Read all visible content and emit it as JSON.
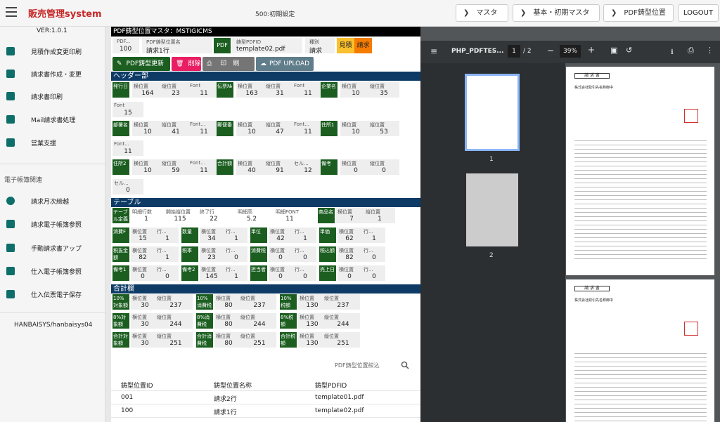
{
  "app": {
    "title": "販売管理system",
    "screen": "500:初期設定",
    "version": "VER:1.0.1",
    "user": "HANBAISYS/hanbaisys04"
  },
  "nav": {
    "master": "マスタ",
    "basic_master": "基本・初期マスタ",
    "pdf_position": "PDF鋳型位置",
    "logout": "LOGOUT"
  },
  "sidebar": {
    "items": [
      {
        "label": "見積作成変更印刷"
      },
      {
        "label": "請求書作成・変更"
      },
      {
        "label": "請求書印刷"
      },
      {
        "label": "Mail請求書処理"
      },
      {
        "label": "営業支援"
      }
    ],
    "section": "電子帳簿関連",
    "items2": [
      {
        "label": "請求月次締越"
      },
      {
        "label": "請求電子帳簿参照"
      },
      {
        "label": "手動請求書アップ"
      },
      {
        "label": "仕入電子帳簿参照"
      },
      {
        "label": "仕入伝票電子保存"
      }
    ]
  },
  "main": {
    "title": "PDF鋳型位置マスタ：MSTIGICMS",
    "hdr": {
      "pdf_lbl": "PDF...",
      "pdf_val": "100",
      "name_lbl": "PDF鋳型位置名",
      "name_val": "請求1行",
      "pdfbadge": "PDF",
      "pdfid_lbl": "鋳型PDFID",
      "pdfid_val": "template02.pdf",
      "type_lbl": "種別",
      "type_val": "請求",
      "t1": "見積",
      "t2": "請求"
    },
    "actions": {
      "update": "PDF鋳型更新",
      "delete": "削除",
      "print": "印　刷",
      "upload": "PDF UPLOAD"
    },
    "sections": {
      "header": "ヘッダー部",
      "table": "テーブル",
      "total": "合計欄"
    },
    "header_rows": [
      {
        "tag": "発行日",
        "p": [
          [
            "横位置",
            "164"
          ],
          [
            "縦位置",
            "23"
          ],
          [
            "Font",
            "11"
          ]
        ]
      },
      {
        "tag": "伝票№",
        "p": [
          [
            "横位置",
            "163"
          ],
          [
            "縦位置",
            "31"
          ],
          [
            "Font",
            "11"
          ]
        ]
      },
      {
        "tag": "企業名",
        "p": [
          [
            "横位置",
            "10"
          ],
          [
            "縦位置",
            "35"
          ]
        ]
      }
    ],
    "header_extra1": [
      "Font",
      "15"
    ],
    "header_rows2": [
      {
        "tag": "部署名",
        "p": [
          [
            "横位置",
            "10"
          ],
          [
            "縦位置",
            "41"
          ],
          [
            "Font...",
            "11"
          ]
        ]
      },
      {
        "tag": "郵便番",
        "p": [
          [
            "横位置",
            "10"
          ],
          [
            "縦位置",
            "47"
          ],
          [
            "Font...",
            "11"
          ]
        ]
      },
      {
        "tag": "住所1",
        "p": [
          [
            "横位置",
            "10"
          ],
          [
            "縦位置",
            "53"
          ]
        ]
      }
    ],
    "header_extra2": [
      "Font...",
      "11"
    ],
    "header_rows3": [
      {
        "tag": "住所2",
        "p": [
          [
            "横位置",
            "10"
          ],
          [
            "縦位置",
            "59"
          ],
          [
            "Font...",
            "11"
          ]
        ]
      },
      {
        "tag": "合計額",
        "p": [
          [
            "横位置",
            "40"
          ],
          [
            "縦位置",
            "91"
          ],
          [
            "セル...",
            "12"
          ]
        ]
      },
      {
        "tag": "備考",
        "p": [
          [
            "横位置",
            "0"
          ],
          [
            "縦位置",
            "0"
          ]
        ]
      }
    ],
    "header_extra3": [
      "セル...",
      "0"
    ],
    "table_top": {
      "tag": "テーブル定義",
      "p": [
        [
          "明細行数",
          "1"
        ],
        [
          "開始縦位置",
          "115"
        ],
        [
          "終了行",
          "22"
        ],
        [
          "明細高",
          "5.2"
        ],
        [
          "明細FONT",
          "11"
        ]
      ],
      "tag2": "商品名",
      "p2": [
        [
          "横位置",
          "7"
        ],
        [
          "縦位置",
          "1"
        ]
      ]
    },
    "table_rows": [
      [
        [
          "消費F",
          "15",
          "1"
        ],
        [
          "数量",
          "34",
          "1"
        ],
        [
          "単位",
          "42",
          "1"
        ],
        [
          "単価",
          "62",
          "1"
        ]
      ],
      [
        [
          "税抜金額",
          "82",
          "1"
        ],
        [
          "税率",
          "23",
          "0"
        ],
        [
          "消費税",
          "0",
          "0"
        ],
        [
          "税込額",
          "82",
          "0"
        ]
      ],
      [
        [
          "備考1",
          "0",
          "0"
        ],
        [
          "備考2",
          "145",
          "1"
        ],
        [
          "担当者",
          "0",
          "0"
        ],
        [
          "売上日",
          "0",
          "0"
        ]
      ]
    ],
    "total_rows": [
      [
        [
          "10%対象額",
          "30",
          "237"
        ],
        [
          "10%消費税",
          "80",
          "237"
        ],
        [
          "10%税額",
          "130",
          "237"
        ]
      ],
      [
        [
          "8%対象額",
          "30",
          "244"
        ],
        [
          "8%消費税",
          "80",
          "244"
        ],
        [
          "8%税額",
          "130",
          "244"
        ]
      ],
      [
        [
          "合計対象額",
          "30",
          "251"
        ],
        [
          "合計消費税",
          "80",
          "251"
        ],
        [
          "合計税額",
          "130",
          "251"
        ]
      ]
    ],
    "search": "PDF鋳型位置絞込",
    "list_headers": [
      "鋳型位置ID",
      "鋳型位置名称",
      "鋳型PDFID"
    ],
    "list_rows": [
      [
        "001",
        "請求2行",
        "template01.pdf"
      ],
      [
        "100",
        "請求1行",
        "template02.pdf"
      ]
    ]
  },
  "pdf": {
    "filename": "PHP_PDFTES...",
    "page": "1",
    "pages": "/ 2",
    "zoom": "39%",
    "thumb1": "1",
    "thumb2": "2",
    "doc_title": "請 求 書",
    "addr": "株式会社取引先名称御中"
  }
}
